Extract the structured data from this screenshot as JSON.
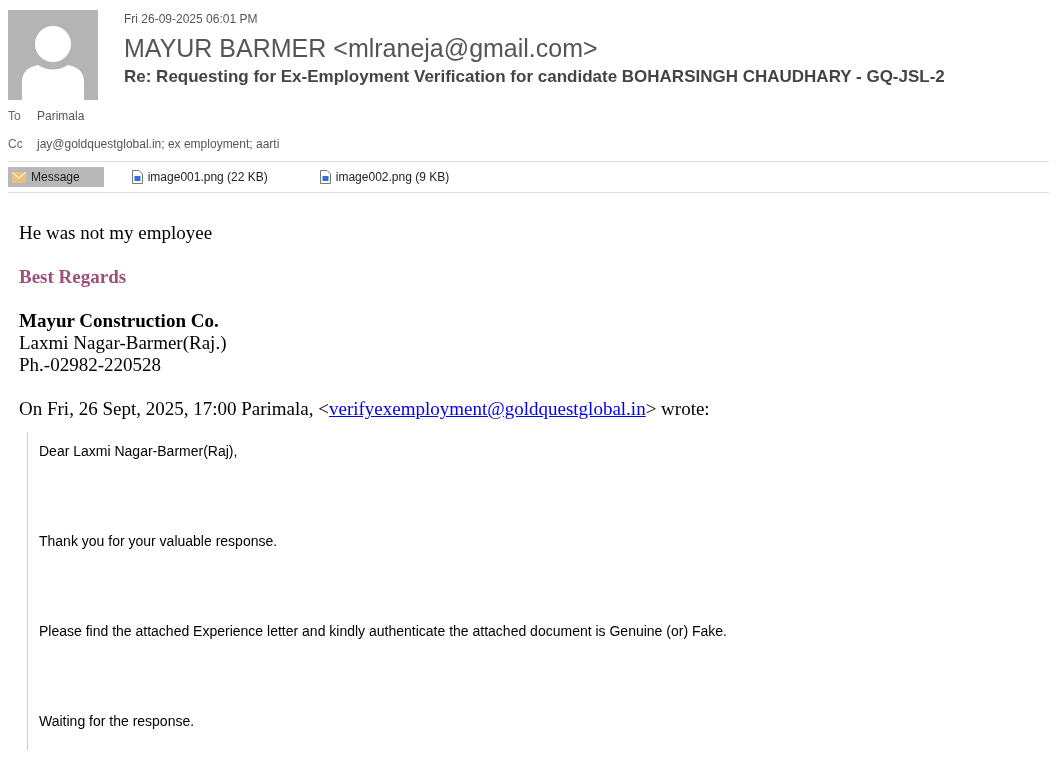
{
  "header": {
    "date": "Fri 26-09-2025 06:01 PM",
    "sender": "MAYUR BARMER <mlraneja@gmail.com>",
    "subject": "Re: Requesting for Ex-Employment Verification for candidate BOHARSINGH CHAUDHARY - GQ-JSL-2",
    "recipients": [
      {
        "label": "To",
        "value": "Parimala"
      },
      {
        "label": "Cc",
        "value": "jay@goldquestglobal.in; ex employment; aarti"
      }
    ]
  },
  "attachments": [
    {
      "kind": "message",
      "label": "Message",
      "selected": true
    },
    {
      "kind": "file",
      "label": "image001.png (22 KB)",
      "selected": false
    },
    {
      "kind": "file",
      "label": "image002.png (9 KB)",
      "selected": false
    }
  ],
  "body": {
    "reply": "He was not my employee",
    "regards": "Best Regards",
    "signature": [
      {
        "kind": "company",
        "text": "Mayur Construction Co."
      },
      {
        "kind": "line",
        "text": "Laxmi Nagar-Barmer(Raj.)"
      },
      {
        "kind": "line",
        "text": "Ph.-02982-220528"
      }
    ],
    "quote_intro": {
      "before": "On Fri, 26 Sept, 2025, 17:00 Parimala, <",
      "link": "verifyexemployment@goldquestglobal.in",
      "after": "> wrote:"
    },
    "quoted": [
      "Dear Laxmi Nagar-Barmer(Raj),",
      "Thank you for your valuable response.",
      "Please find the attached Experience letter and kindly authenticate the attached document is Genuine (or) Fake.",
      "Waiting for the response."
    ]
  }
}
